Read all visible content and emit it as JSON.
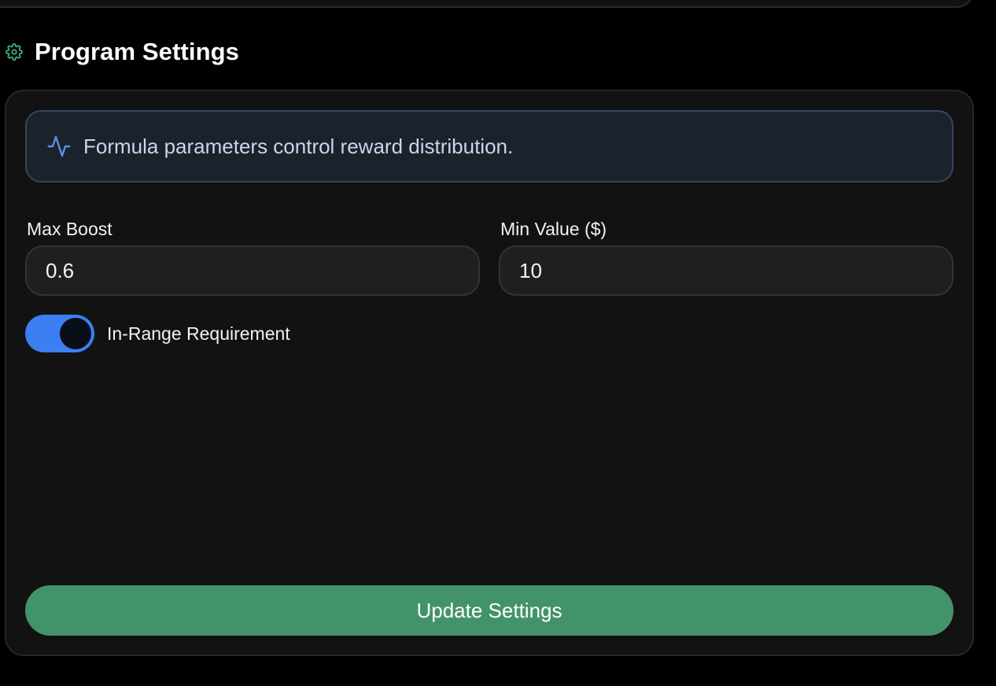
{
  "section": {
    "title": "Program Settings",
    "icon": "gear-icon",
    "icon_color": "#3fae7a"
  },
  "info_banner": {
    "icon": "pulse-icon",
    "text": "Formula parameters control reward distribution.",
    "accent_color": "#5b8fe0"
  },
  "fields": {
    "max_boost": {
      "label": "Max Boost",
      "value": "0.6"
    },
    "min_value": {
      "label": "Min Value ($)",
      "value": "10"
    }
  },
  "toggle": {
    "label": "In-Range Requirement",
    "checked": true,
    "color": "#3b7ff0"
  },
  "update_button": {
    "label": "Update Settings",
    "color": "#43936a"
  }
}
